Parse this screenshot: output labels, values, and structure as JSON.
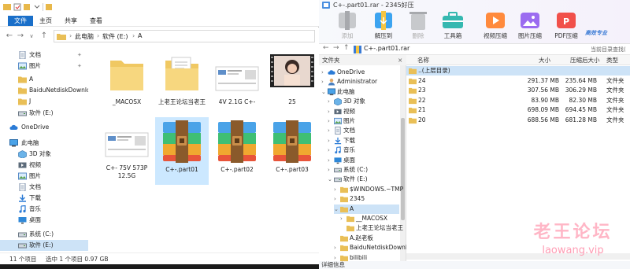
{
  "explorer": {
    "ribbon_tabs": [
      "文件",
      "主页",
      "共享",
      "查看"
    ],
    "breadcrumb": [
      "此电脑",
      "软件 (E:)",
      "A"
    ],
    "nav_items": [
      {
        "label": "文档",
        "icon": "document-icon",
        "pinned": true
      },
      {
        "label": "图片",
        "icon": "picture-icon",
        "pinned": true
      },
      {
        "label": "A",
        "icon": "folder-icon",
        "pinned": false
      },
      {
        "label": "BaiduNetdiskDownlo",
        "icon": "folder-icon",
        "pinned": false
      },
      {
        "label": "J",
        "icon": "folder-icon",
        "pinned": false
      },
      {
        "label": "软件 (E:)",
        "icon": "drive-icon",
        "pinned": false
      },
      {
        "label": "OneDrive",
        "icon": "cloud-icon",
        "pinned": false
      },
      {
        "label": "此电脑",
        "icon": "computer-icon",
        "pinned": false
      },
      {
        "label": "3D 对象",
        "icon": "cube-icon",
        "pinned": false
      },
      {
        "label": "视频",
        "icon": "video-icon",
        "pinned": false
      },
      {
        "label": "图片",
        "icon": "picture-icon",
        "pinned": false
      },
      {
        "label": "文档",
        "icon": "document-icon",
        "pinned": false
      },
      {
        "label": "下载",
        "icon": "download-icon",
        "pinned": false
      },
      {
        "label": "音乐",
        "icon": "music-icon",
        "pinned": false
      },
      {
        "label": "桌面",
        "icon": "desktop-icon",
        "pinned": false
      },
      {
        "label": "系统 (C:)",
        "icon": "drive-icon",
        "pinned": false
      },
      {
        "label": "软件 (E:)",
        "icon": "drive-icon",
        "pinned": false
      }
    ],
    "files": [
      {
        "name": "_MACOSX",
        "kind": "folder"
      },
      {
        "name": "上老王论坛当老王",
        "kind": "folder-doc"
      },
      {
        "name": "4V 2.1G C+-",
        "kind": "image"
      },
      {
        "name": "25",
        "kind": "video"
      },
      {
        "name": "C+- 75V 573P 12.5G",
        "kind": "image"
      },
      {
        "name": "C+-.part01",
        "kind": "archive"
      },
      {
        "name": "C+-.part02",
        "kind": "archive"
      },
      {
        "name": "C+-.part03",
        "kind": "archive"
      }
    ],
    "status": {
      "count": "11 个项目",
      "selection": "选中 1 个项目  0.97 GB"
    }
  },
  "archiver": {
    "title": "C+-.part01.rar - 2345好压",
    "toolbar": [
      {
        "label": "添加",
        "icon": "add-archive-icon",
        "disabled": true
      },
      {
        "label": "解压到",
        "icon": "extract-icon",
        "disabled": false
      },
      {
        "label": "删除",
        "icon": "delete-icon",
        "disabled": true
      },
      {
        "label": "工具箱",
        "icon": "toolbox-icon",
        "disabled": false
      },
      {
        "label": "视频压缩",
        "icon": "video-compress-icon",
        "disabled": false
      },
      {
        "label": "图片压缩",
        "icon": "image-compress-icon",
        "disabled": false
      },
      {
        "label": "PDF压缩",
        "icon": "pdf-compress-icon",
        "disabled": false
      }
    ],
    "brand_badge": "高效专业",
    "path": "C+-.part01.rar",
    "search_placeholder": "当前目录查找(",
    "folders_header": "文件夹",
    "tree": [
      {
        "label": "OneDrive",
        "icon": "cloud-icon",
        "indent": 1,
        "expand": ">"
      },
      {
        "label": "Administrator",
        "icon": "user-icon",
        "indent": 1,
        "expand": ">"
      },
      {
        "label": "此电脑",
        "icon": "computer-icon",
        "indent": 1,
        "expand": "v"
      },
      {
        "label": "3D 对象",
        "icon": "cube-icon",
        "indent": 2,
        "expand": ">"
      },
      {
        "label": "视频",
        "icon": "video-icon",
        "indent": 2,
        "expand": ">"
      },
      {
        "label": "图片",
        "icon": "picture-icon",
        "indent": 2,
        "expand": ">"
      },
      {
        "label": "文档",
        "icon": "document-icon",
        "indent": 2,
        "expand": ">"
      },
      {
        "label": "下载",
        "icon": "download-icon",
        "indent": 2,
        "expand": ">"
      },
      {
        "label": "音乐",
        "icon": "music-icon",
        "indent": 2,
        "expand": ">"
      },
      {
        "label": "桌面",
        "icon": "desktop-icon",
        "indent": 2,
        "expand": ">"
      },
      {
        "label": "系统 (C:)",
        "icon": "drive-icon",
        "indent": 2,
        "expand": ">"
      },
      {
        "label": "软件 (E:)",
        "icon": "drive-icon",
        "indent": 2,
        "expand": "v"
      },
      {
        "label": "$WINDOWS.~TMP",
        "icon": "folder-icon",
        "indent": 3,
        "expand": ">"
      },
      {
        "label": "2345",
        "icon": "folder-icon",
        "indent": 3,
        "expand": ">"
      },
      {
        "label": "A",
        "icon": "folder-icon",
        "indent": 3,
        "expand": "v"
      },
      {
        "label": "__MACOSX",
        "icon": "folder-icon",
        "indent": 4,
        "expand": ">"
      },
      {
        "label": "上老王论坛当老王",
        "icon": "folder-icon",
        "indent": 4,
        "expand": ""
      },
      {
        "label": "A.赵老板",
        "icon": "folder-icon",
        "indent": 3,
        "expand": ""
      },
      {
        "label": "BaiduNetdiskDownl",
        "icon": "folder-icon",
        "indent": 3,
        "expand": ">"
      },
      {
        "label": "bilibili",
        "icon": "folder-icon",
        "indent": 3,
        "expand": ">"
      }
    ],
    "columns": [
      "名称",
      "大小",
      "压缩后大小",
      "类型"
    ],
    "rows": [
      {
        "name": "..(上层目录)",
        "size": "",
        "packed": "",
        "type": "",
        "parent": true
      },
      {
        "name": "24",
        "size": "291.37 MB",
        "packed": "235.64 MB",
        "type": "文件夹"
      },
      {
        "name": "23",
        "size": "307.56 MB",
        "packed": "306.29 MB",
        "type": "文件夹"
      },
      {
        "name": "22",
        "size": "83.90 MB",
        "packed": "82.30 MB",
        "type": "文件夹"
      },
      {
        "name": "21",
        "size": "698.09 MB",
        "packed": "694.45 MB",
        "type": "文件夹"
      },
      {
        "name": "20",
        "size": "688.56 MB",
        "packed": "681.28 MB",
        "type": "文件夹"
      }
    ],
    "status": "详细信息"
  },
  "watermark": {
    "cn": "老王论坛",
    "en": "laowang.vip"
  }
}
